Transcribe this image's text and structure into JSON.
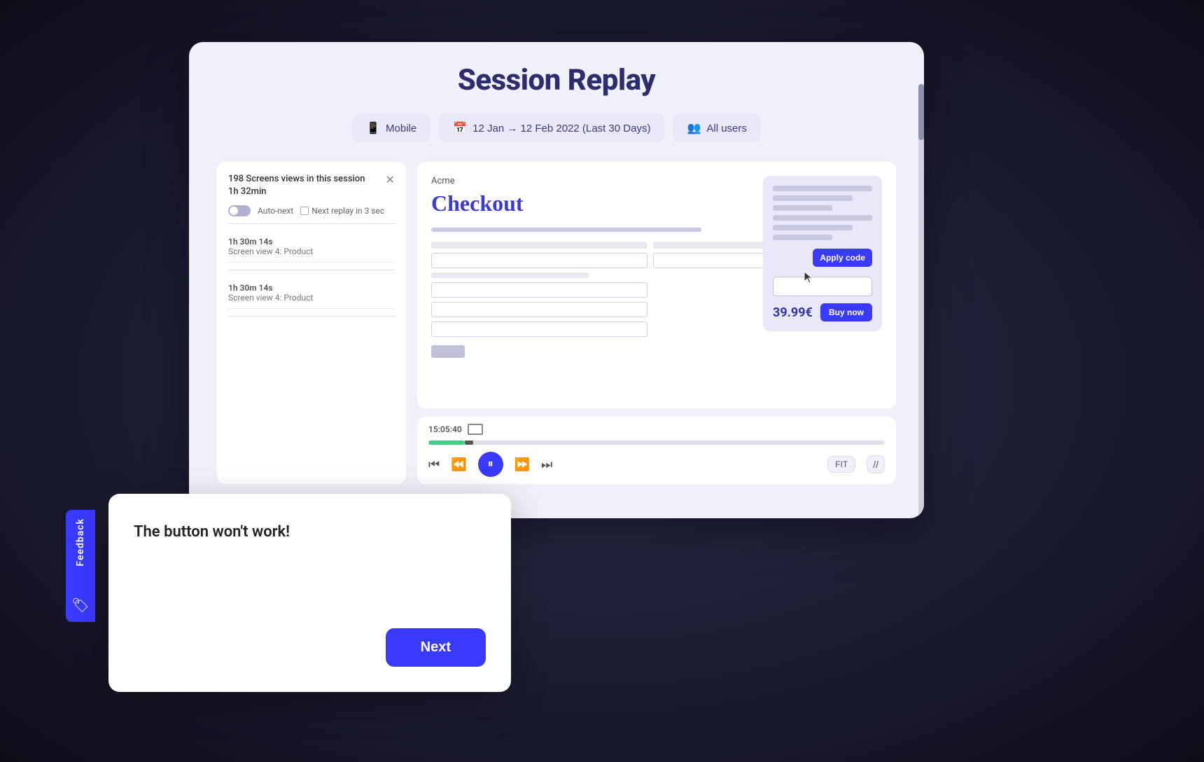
{
  "page": {
    "title": "Session Replay",
    "background": "#1a1a2e"
  },
  "filters": {
    "device": {
      "label": "Mobile",
      "icon": "📱"
    },
    "date": {
      "label": "12 Jan → 12 Feb 2022 (Last 30 Days)",
      "icon": "📅"
    },
    "users": {
      "label": "All users",
      "icon": "👥"
    }
  },
  "session_panel": {
    "count_text": "198 Screens views in this session",
    "duration": "1h 32min",
    "auto_next_label": "Auto-next",
    "next_replay_label": "Next replay in 3 sec",
    "items": [
      {
        "time": "1h 30m 14s",
        "description": "Screen view 4: Product"
      },
      {
        "time": "1h 30m 14s",
        "description": "Screen view 4: Product"
      }
    ]
  },
  "checkout": {
    "brand": "Acme",
    "title": "Checkout",
    "apply_code_label": "Apply code",
    "price": "39.99€",
    "buy_now_label": "Buy now"
  },
  "player": {
    "time": "15:05:40",
    "fit_label": "FIT"
  },
  "feedback": {
    "tab_label": "Feedback",
    "message": "The button won't work!",
    "next_label": "Next"
  }
}
